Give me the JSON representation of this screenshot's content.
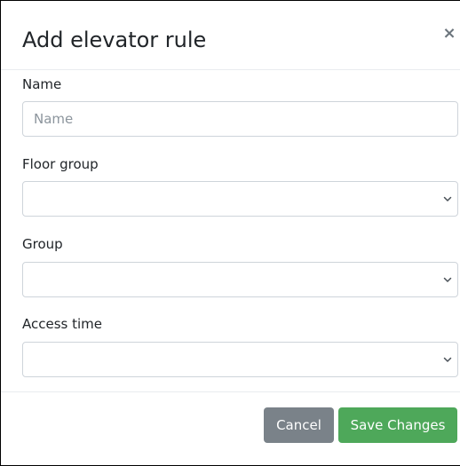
{
  "dialog": {
    "title": "Add elevator rule",
    "close_label": "×"
  },
  "fields": {
    "name": {
      "label": "Name",
      "placeholder": "Name",
      "value": ""
    },
    "floor_group": {
      "label": "Floor group",
      "selected": ""
    },
    "group": {
      "label": "Group",
      "selected": ""
    },
    "access_time": {
      "label": "Access time",
      "selected": ""
    }
  },
  "footer": {
    "cancel_label": "Cancel",
    "save_label": "Save Changes"
  },
  "colors": {
    "cancel_button": "#7a8289",
    "save_button": "#4ea85a",
    "input_border": "#ced4da"
  },
  "icons": {
    "close": "close-icon",
    "select_arrow": "chevron-down-icon"
  }
}
